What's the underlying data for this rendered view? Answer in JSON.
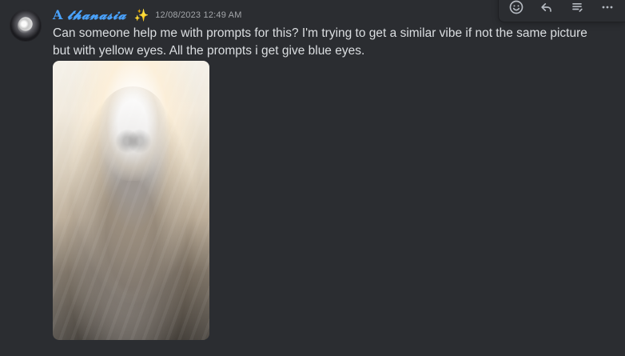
{
  "message": {
    "author": {
      "display_name_prefix": "A ",
      "display_name_script": "𝓽𝓱𝓪𝓷𝓪𝓼𝓲𝓪",
      "badge_icon": "sparkles-icon",
      "name_color": "#4aa3ff"
    },
    "timestamp": "12/08/2023 12:49 AM",
    "text": "Can someone help me with prompts for this? I'm trying to get a similar vibe if not the same picture but with yellow eyes. All the prompts i get give blue eyes.",
    "attachment": {
      "kind": "image",
      "alt": ""
    }
  },
  "toolbar": {
    "actions": [
      {
        "icon": "add-reaction-icon"
      },
      {
        "icon": "reply-icon"
      },
      {
        "icon": "create-thread-icon"
      },
      {
        "icon": "more-options-icon"
      }
    ]
  },
  "colors": {
    "background": "#2b2d31",
    "text": "#dbdee1",
    "timestamp": "#a3a6aa",
    "icon": "#b5bac1"
  }
}
